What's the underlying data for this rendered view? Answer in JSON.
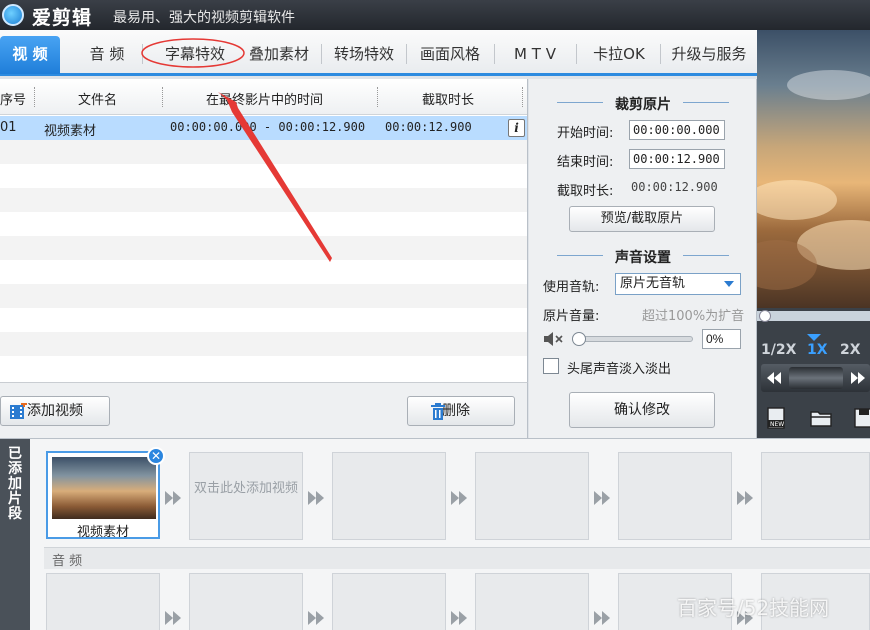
{
  "titlebar": {
    "app_name": "爱剪辑",
    "slogan": "最易用、强大的视频剪辑软件"
  },
  "tabs": [
    {
      "label": "视 频",
      "active": true
    },
    {
      "label": "音 频"
    },
    {
      "label": "字幕特效"
    },
    {
      "label": "叠加素材"
    },
    {
      "label": "转场特效"
    },
    {
      "label": "画面风格"
    },
    {
      "label": "M T V"
    },
    {
      "label": "卡拉OK"
    },
    {
      "label": "升级与服务"
    }
  ],
  "table": {
    "headers": {
      "index": "序号",
      "filename": "文件名",
      "timeline": "在最终影片中的时间",
      "duration": "截取时长"
    },
    "rows": [
      {
        "index": "01",
        "filename": "视频素材",
        "timeline": "00:00:00.000 - 00:00:12.900",
        "duration": "00:00:12.900",
        "info": "i"
      }
    ]
  },
  "left_buttons": {
    "add_video": "添加视频",
    "delete": "删除"
  },
  "trim_panel": {
    "title": "裁剪原片",
    "start_label": "开始时间:",
    "start_value": "00:00:00.000",
    "end_label": "结束时间:",
    "end_value": "00:00:12.900",
    "duration_label": "截取时长:",
    "duration_value": "00:00:12.900",
    "preview_button": "预览/截取原片"
  },
  "sound_panel": {
    "title": "声音设置",
    "track_label": "使用音轨:",
    "track_value": "原片无音轨",
    "volume_label": "原片音量:",
    "volume_hint": "超过100%为扩音",
    "volume_value": "0%",
    "volume_level": 0,
    "fade_label": "头尾声音淡入淡出",
    "confirm_button": "确认修改"
  },
  "player": {
    "speeds": [
      {
        "label": "1/2X"
      },
      {
        "label": "1X",
        "active": true
      },
      {
        "label": "2X"
      }
    ],
    "progress": 0
  },
  "storyboard": {
    "side_label": "已添加片段",
    "clip_label": "视频素材",
    "close_glyph": "✕",
    "hint": "双击此处添加视频",
    "audio_label": "音 频"
  },
  "watermark": "百家号/52技能网",
  "colors": {
    "accent": "#2d8be0",
    "annotation": "#e53935",
    "selected_row": "#b9dcff"
  },
  "icons": {
    "add_video": "film-add-icon",
    "delete": "trash-icon",
    "new_project": "new-file-icon",
    "open_project": "folder-icon",
    "save_project": "save-icon"
  }
}
